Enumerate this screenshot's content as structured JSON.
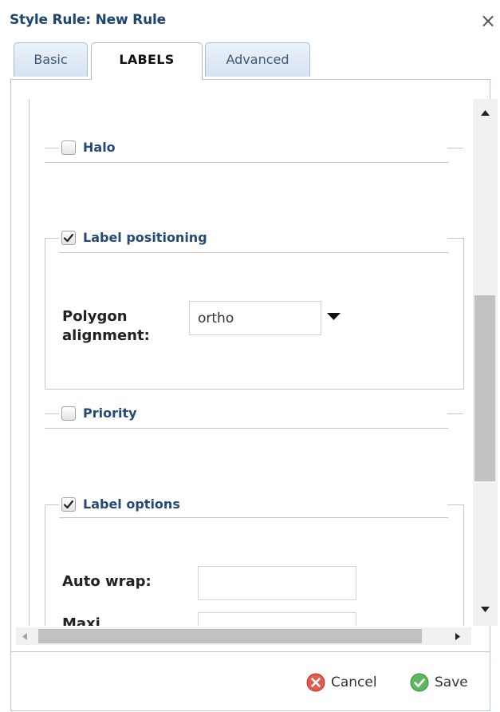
{
  "dialog": {
    "title": "Style Rule: New Rule",
    "close_symbol": "×"
  },
  "tabs": [
    {
      "label": "Basic",
      "active": false
    },
    {
      "label": "LABELS",
      "active": true
    },
    {
      "label": "Advanced",
      "active": false
    }
  ],
  "sections": {
    "halo": {
      "label": "Halo",
      "checked": false
    },
    "label_positioning": {
      "label": "Label positioning",
      "checked": true,
      "polygon_alignment": {
        "label_line1": "Polygon",
        "label_line2": "alignment:",
        "value": "ortho"
      }
    },
    "priority": {
      "label": "Priority",
      "checked": false
    },
    "label_options": {
      "label": "Label options",
      "checked": true,
      "auto_wrap": {
        "label": "Auto wrap:",
        "value": ""
      },
      "next_field": {
        "label": "Maxi",
        "value": ""
      }
    }
  },
  "footer": {
    "cancel_label": "Cancel",
    "save_label": "Save"
  },
  "colors": {
    "title": "#1d4570",
    "legend": "#244a79",
    "cancel_icon": "#e05a4e",
    "save_icon": "#5cb85c"
  }
}
